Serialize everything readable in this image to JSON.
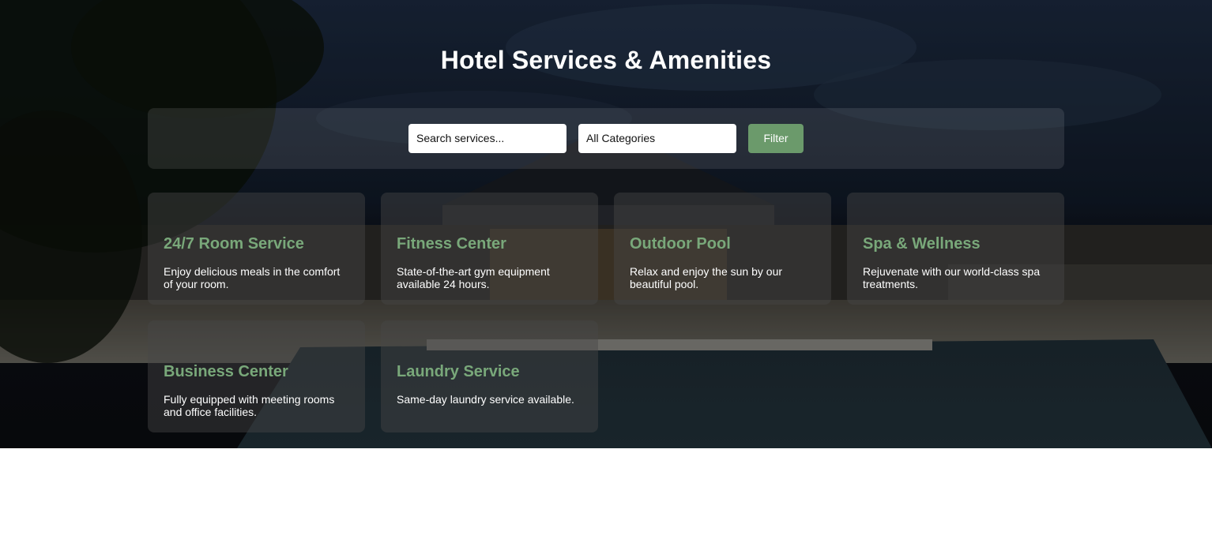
{
  "page": {
    "title": "Hotel Services & Amenities"
  },
  "filters": {
    "search_placeholder": "Search services...",
    "category_selected": "All Categories",
    "filter_label": "Filter"
  },
  "services": [
    {
      "title": "24/7 Room Service",
      "description": "Enjoy delicious meals in the comfort of your room."
    },
    {
      "title": "Fitness Center",
      "description": "State-of-the-art gym equipment available 24 hours."
    },
    {
      "title": "Outdoor Pool",
      "description": "Relax and enjoy the sun by our beautiful pool."
    },
    {
      "title": "Spa & Wellness",
      "description": "Rejuvenate with our world-class spa treatments."
    },
    {
      "title": "Business Center",
      "description": "Fully equipped with meeting rooms and office facilities."
    },
    {
      "title": "Laundry Service",
      "description": "Same-day laundry service available."
    }
  ],
  "colors": {
    "accent": "#6b9a6b",
    "card_title": "#79a87a",
    "text": "#ffffff"
  }
}
